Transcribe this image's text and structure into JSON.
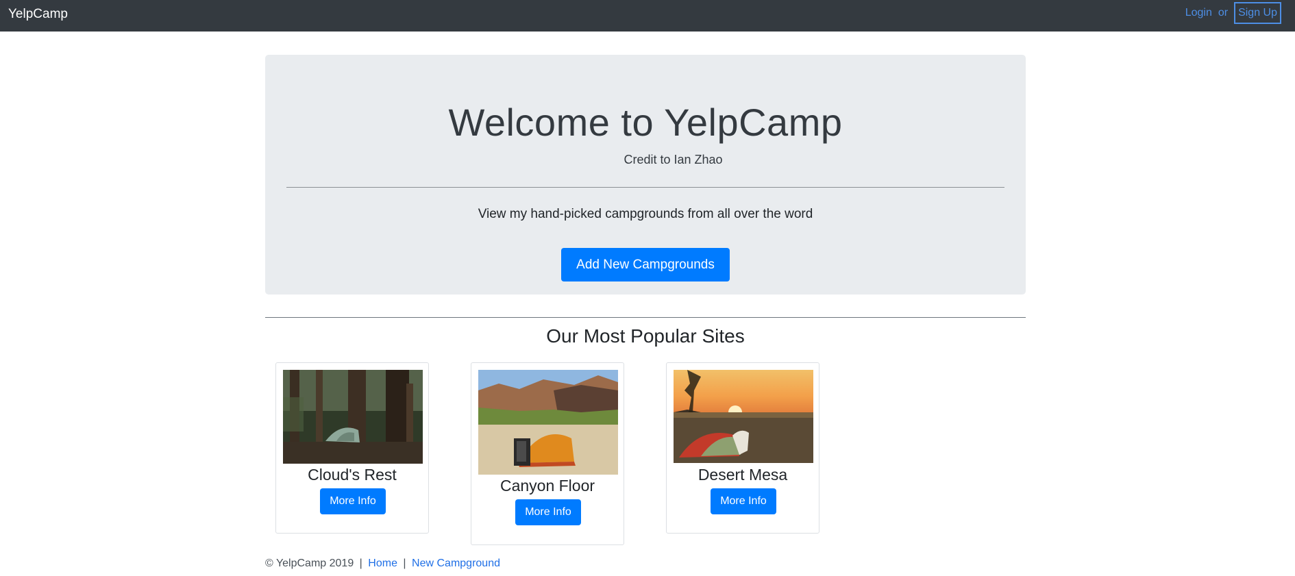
{
  "navbar": {
    "brand": "YelpCamp",
    "login_label": "Login",
    "or_label": "or",
    "signup_label": "Sign Up"
  },
  "jumbotron": {
    "title": "Welcome to YelpCamp",
    "credit": "Credit to Ian Zhao",
    "lead": "View my hand-picked campgrounds from all over the word",
    "add_button": "Add New Campgrounds"
  },
  "popular": {
    "title": "Our Most Popular Sites",
    "cards": [
      {
        "name": "Cloud's Rest",
        "button": "More Info"
      },
      {
        "name": "Canyon Floor",
        "button": "More Info"
      },
      {
        "name": "Desert Mesa",
        "button": "More Info"
      }
    ]
  },
  "footer": {
    "copyright": "© YelpCamp 2019",
    "separator": "|",
    "home_link": "Home",
    "new_campground_link": "New Campground"
  },
  "colors": {
    "navbar_bg": "#343a40",
    "jumbotron_bg": "#e9ecef",
    "primary": "#007bff",
    "link": "#4d8fe6"
  }
}
